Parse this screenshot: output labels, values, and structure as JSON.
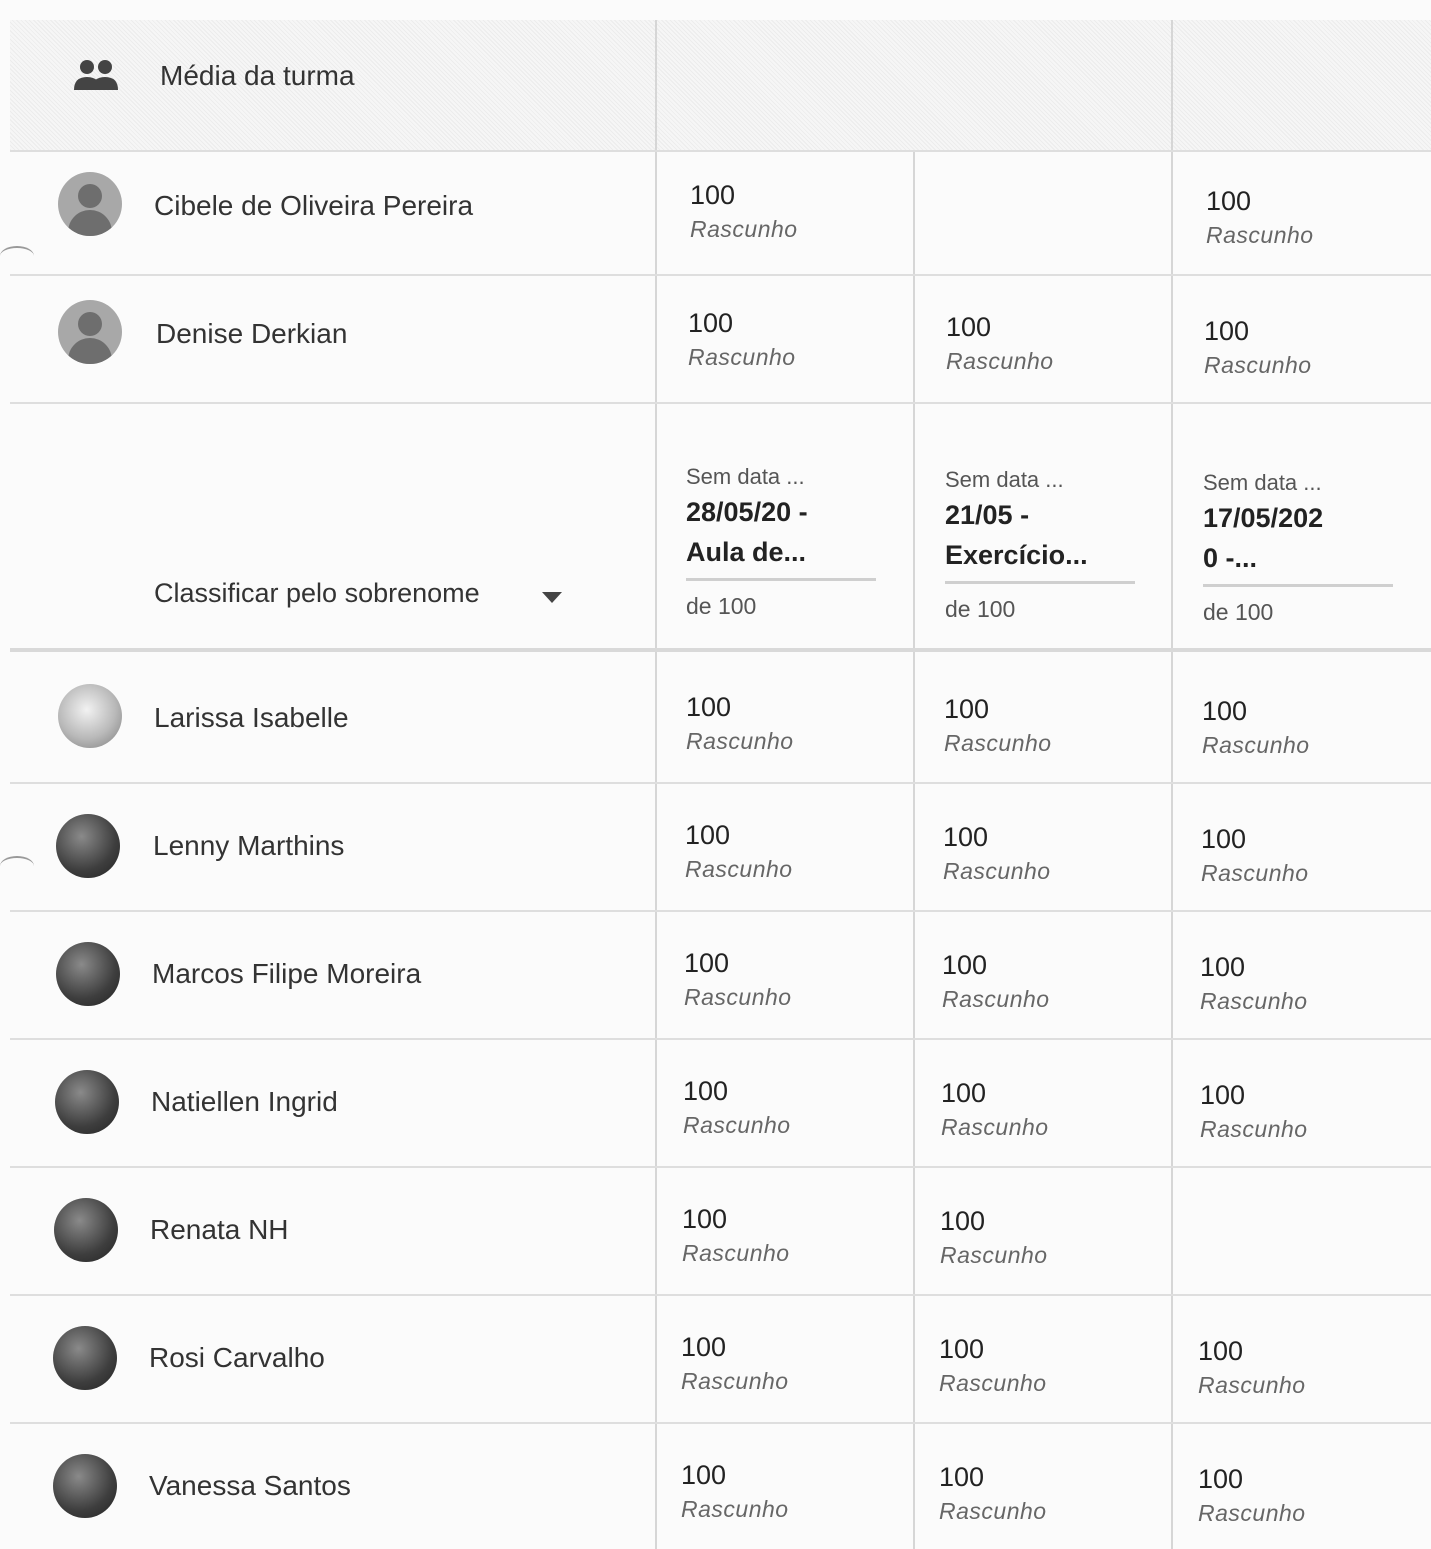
{
  "class_average": {
    "label": "Média da turma",
    "icon": "group-icon"
  },
  "sort": {
    "label": "Classificar pelo sobrenome",
    "icon": "dropdown-arrow-icon"
  },
  "assignments": [
    {
      "no_date": "Sem data ...",
      "title_line1": "28/05/20 -",
      "title_line2": "Aula de...",
      "max": "de 100"
    },
    {
      "no_date": "Sem data ...",
      "title_line1": "21/05 -",
      "title_line2": "Exercício...",
      "max": "de 100"
    },
    {
      "no_date": "Sem data ...",
      "title_line1": "17/05/202",
      "title_line2": "0 -...",
      "max": "de 100"
    }
  ],
  "top_students": [
    {
      "name": "Cibele de Oliveira Pereira",
      "avatar": "default-avatar-icon",
      "grades": [
        {
          "value": "100",
          "status": "Rascunho"
        },
        {
          "value": "",
          "status": ""
        },
        {
          "value": "100",
          "status": "Rascunho"
        }
      ]
    },
    {
      "name": "Denise Derkian",
      "avatar": "default-avatar-icon",
      "grades": [
        {
          "value": "100",
          "status": "Rascunho"
        },
        {
          "value": "100",
          "status": "Rascunho"
        },
        {
          "value": "100",
          "status": "Rascunho"
        }
      ]
    }
  ],
  "students": [
    {
      "name": "Larissa Isabelle",
      "avatar": "photo",
      "grades": [
        {
          "value": "100",
          "status": "Rascunho"
        },
        {
          "value": "100",
          "status": "Rascunho"
        },
        {
          "value": "100",
          "status": "Rascunho"
        }
      ]
    },
    {
      "name": "Lenny Marthins",
      "avatar": "photo",
      "grades": [
        {
          "value": "100",
          "status": "Rascunho"
        },
        {
          "value": "100",
          "status": "Rascunho"
        },
        {
          "value": "100",
          "status": "Rascunho"
        }
      ]
    },
    {
      "name": "Marcos Filipe Moreira",
      "avatar": "photo",
      "grades": [
        {
          "value": "100",
          "status": "Rascunho"
        },
        {
          "value": "100",
          "status": "Rascunho"
        },
        {
          "value": "100",
          "status": "Rascunho"
        }
      ]
    },
    {
      "name": "Natiellen Ingrid",
      "avatar": "photo",
      "grades": [
        {
          "value": "100",
          "status": "Rascunho"
        },
        {
          "value": "100",
          "status": "Rascunho"
        },
        {
          "value": "100",
          "status": "Rascunho"
        }
      ]
    },
    {
      "name": "Renata NH",
      "avatar": "photo",
      "grades": [
        {
          "value": "100",
          "status": "Rascunho"
        },
        {
          "value": "100",
          "status": "Rascunho"
        },
        {
          "value": "",
          "status": ""
        }
      ]
    },
    {
      "name": "Rosi Carvalho",
      "avatar": "photo",
      "grades": [
        {
          "value": "100",
          "status": "Rascunho"
        },
        {
          "value": "100",
          "status": "Rascunho"
        },
        {
          "value": "100",
          "status": "Rascunho"
        }
      ]
    },
    {
      "name": "Vanessa Santos",
      "avatar": "photo",
      "grades": [
        {
          "value": "100",
          "status": "Rascunho"
        },
        {
          "value": "100",
          "status": "Rascunho"
        },
        {
          "value": "100",
          "status": "Rascunho"
        }
      ]
    }
  ]
}
